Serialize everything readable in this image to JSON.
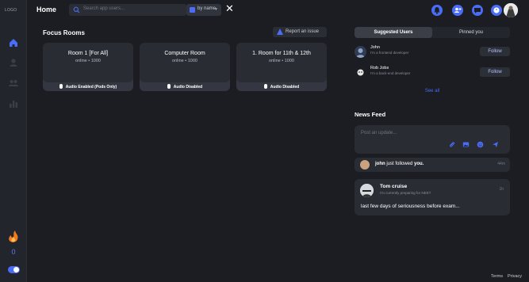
{
  "sidebar": {
    "logo": "LOGO",
    "streak_count": "0",
    "icons": [
      "home-icon",
      "user-icon",
      "group-icon",
      "chart-icon",
      "fire-icon"
    ],
    "accent": "#4a6cf7"
  },
  "header": {
    "title": "Home",
    "search_placeholder": "Search app users...",
    "filter_selected": "by name",
    "close_label": "✕"
  },
  "focus_rooms": {
    "title": "Focus Rooms",
    "report_label": "Report an issue",
    "rooms": [
      {
        "name": "Room 1 [For All]",
        "meta": "online • 1000",
        "status": "Audio Enabled (Pods Only)"
      },
      {
        "name": "Computer Room",
        "meta": "online • 1000",
        "status": "Audio Disabled"
      },
      {
        "name": "1. Room for 11th & 12th",
        "meta": "online • 1000",
        "status": "Audio Disabled"
      }
    ]
  },
  "right_panel": {
    "tabs": [
      "Suggested Users",
      "Pinned you"
    ],
    "suggested": [
      {
        "name": "John",
        "bio": "I'm a frontend developer",
        "action": "Follow"
      },
      {
        "name": "Rob Jobs",
        "bio": "I'm a back-end developer",
        "action": "Follow"
      }
    ],
    "see_all": "See all",
    "news_title": "News Feed",
    "compose_placeholder": "Post an update...",
    "activity": {
      "name": "john",
      "middle": " just followed ",
      "target": "you.",
      "time": "44m"
    },
    "post": {
      "name": "Tom cruise",
      "bio": "I'm currently preparing for NEET",
      "time": "1h",
      "body": "last few days of seriousness before exam..."
    }
  },
  "footer": {
    "terms": "Terms",
    "privacy": "Privacy"
  }
}
